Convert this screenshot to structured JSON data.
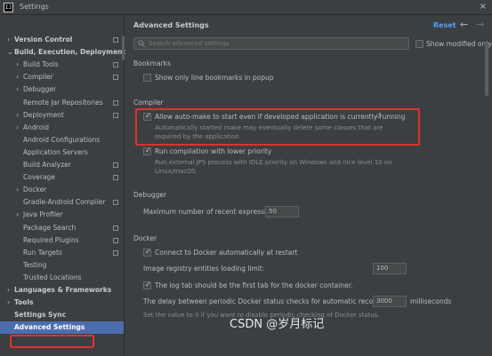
{
  "window": {
    "title": "Settings",
    "app_icon_text": "IJ",
    "close_glyph": "×"
  },
  "sidebar": {
    "items": [
      {
        "label": "Version Control",
        "level": 0,
        "arrow": "›",
        "bold": true,
        "config": true
      },
      {
        "label": "Build, Execution, Deployment",
        "level": 0,
        "arrow": "⌄",
        "bold": true,
        "config": false
      },
      {
        "label": "Build Tools",
        "level": 1,
        "arrow": "›",
        "bold": false,
        "config": true
      },
      {
        "label": "Compiler",
        "level": 1,
        "arrow": "›",
        "bold": false,
        "config": true
      },
      {
        "label": "Debugger",
        "level": 1,
        "arrow": "›",
        "bold": false,
        "config": false
      },
      {
        "label": "Remote Jar Repositories",
        "level": 1,
        "arrow": "",
        "bold": false,
        "config": true
      },
      {
        "label": "Deployment",
        "level": 1,
        "arrow": "›",
        "bold": false,
        "config": true
      },
      {
        "label": "Android",
        "level": 1,
        "arrow": "›",
        "bold": false,
        "config": false
      },
      {
        "label": "Android Configurations",
        "level": 1,
        "arrow": "",
        "bold": false,
        "config": false
      },
      {
        "label": "Application Servers",
        "level": 1,
        "arrow": "",
        "bold": false,
        "config": false
      },
      {
        "label": "Build Analyzer",
        "level": 1,
        "arrow": "",
        "bold": false,
        "config": true
      },
      {
        "label": "Coverage",
        "level": 1,
        "arrow": "",
        "bold": false,
        "config": true
      },
      {
        "label": "Docker",
        "level": 1,
        "arrow": "›",
        "bold": false,
        "config": false
      },
      {
        "label": "Gradle-Android Compiler",
        "level": 1,
        "arrow": "",
        "bold": false,
        "config": true
      },
      {
        "label": "Java Profiler",
        "level": 1,
        "arrow": "›",
        "bold": false,
        "config": false
      },
      {
        "label": "Package Search",
        "level": 1,
        "arrow": "",
        "bold": false,
        "config": true
      },
      {
        "label": "Required Plugins",
        "level": 1,
        "arrow": "",
        "bold": false,
        "config": true
      },
      {
        "label": "Run Targets",
        "level": 1,
        "arrow": "",
        "bold": false,
        "config": true
      },
      {
        "label": "Testing",
        "level": 1,
        "arrow": "",
        "bold": false,
        "config": false
      },
      {
        "label": "Trusted Locations",
        "level": 1,
        "arrow": "",
        "bold": false,
        "config": false
      },
      {
        "label": "Languages & Frameworks",
        "level": 0,
        "arrow": "›",
        "bold": true,
        "config": false
      },
      {
        "label": "Tools",
        "level": 0,
        "arrow": "›",
        "bold": true,
        "config": false
      },
      {
        "label": "Settings Sync",
        "level": 0,
        "arrow": "",
        "bold": true,
        "config": false
      },
      {
        "label": "Advanced Settings",
        "level": 0,
        "arrow": "",
        "bold": true,
        "config": false,
        "selected": true
      }
    ],
    "help_label": "?"
  },
  "main": {
    "title": "Advanced Settings",
    "reset_label": "Reset",
    "back_glyph": "←",
    "forward_glyph": "→",
    "search_placeholder": "Search advanced settings",
    "show_modified_label": "Show modified only",
    "bookmarks": {
      "section": "Bookmarks",
      "option": "Show only line bookmarks in popup"
    },
    "compiler": {
      "section": "Compiler",
      "automake_label": "Allow auto-make to start even if developed application is currently running",
      "automake_desc": "Automatically started make may eventually delete some classes that are required by the application",
      "lowprio_label": "Run compilation with lower priority",
      "lowprio_desc": "Run external JPS process with IDLE priority on Windows and nice level 10 on Linux/macOS"
    },
    "debugger": {
      "section": "Debugger",
      "max_expr_label": "Maximum number of recent expressions:",
      "max_expr_value": "50"
    },
    "docker": {
      "section": "Docker",
      "connect_label": "Connect to Docker automatically at restart",
      "registry_label": "Image registry entities loading limit:",
      "registry_value": "100",
      "logtab_label": "The log tab should be the first tab for the docker container.",
      "delay_label": "The delay between periodic Docker status checks for automatic reconnection:",
      "delay_value": "3000",
      "delay_unit": "milliseconds",
      "delay_desc": "Set the value to 0 if you want to disable periodic checking of Docker status."
    }
  },
  "watermark": "CSDN @岁月标记",
  "colors": {
    "accent": "#589df6",
    "selection": "#4b6eaf",
    "highlight": "#e03030"
  }
}
